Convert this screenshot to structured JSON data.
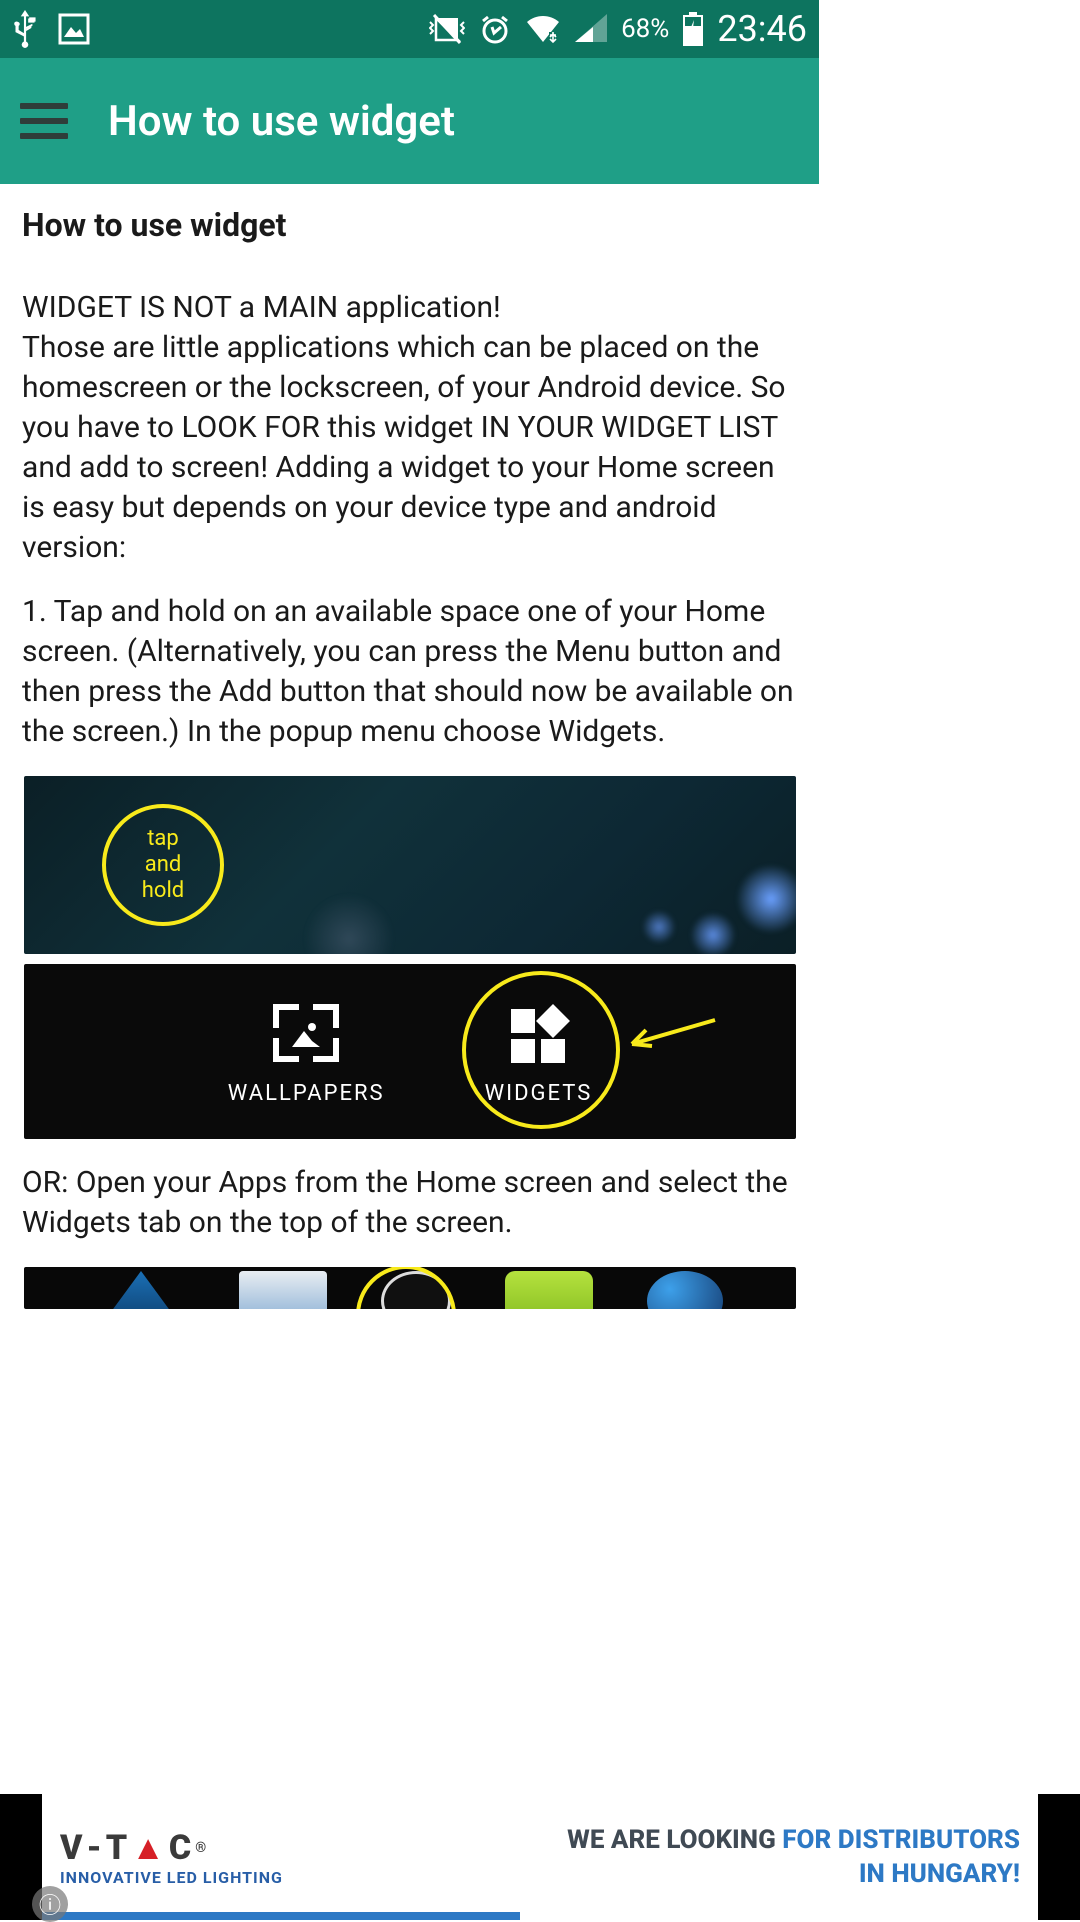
{
  "status": {
    "battery_text": "68%",
    "time": "23:46"
  },
  "appbar": {
    "title": "How to use widget"
  },
  "content": {
    "heading": "How to use widget",
    "intro": "WIDGET IS NOT a MAIN application!\nThose those are little applications which can be placed on the homescreen or the lockscreen, of your Android device. So you have to LOOK FOR this widget IN YOUR WIDGET LIST and add to screen! Adding a widget to your Home screen is easy but depends on your device type and android version:",
    "intro_line1": "WIDGET IS NOT a MAIN application!",
    "intro_rest": "Those are little applications which can be placed on the homescreen or the lockscreen, of your Android device. So you have to LOOK FOR this widget IN YOUR WIDGET LIST and add to screen! Adding a widget to your Home screen is easy but depends on your device type and android version:",
    "step1": "1. Tap and hold on an available space one of your Home screen. (Alternatively, you can press the Menu button and then press the Add button that should now be available on the screen.) In the popup menu choose Widgets.",
    "tap_label_1": "tap",
    "tap_label_2": "and",
    "tap_label_3": "hold",
    "opt_wallpapers": "WALLPAPERS",
    "opt_widgets": "WIDGETS",
    "or_text": "OR: Open your Apps from the Home screen and select the Widgets tab on the top of the screen."
  },
  "ad": {
    "brand_v": "V",
    "brand_dash": "-",
    "brand_t": "T",
    "brand_a": "A",
    "brand_c": "C",
    "brand_r": "®",
    "tagline": "INNOVATIVE LED LIGHTING",
    "line1_a": "WE ARE LOOKING ",
    "line1_b": "FOR DISTRIBUTORS",
    "line2_a": "IN HUNGARY!"
  }
}
